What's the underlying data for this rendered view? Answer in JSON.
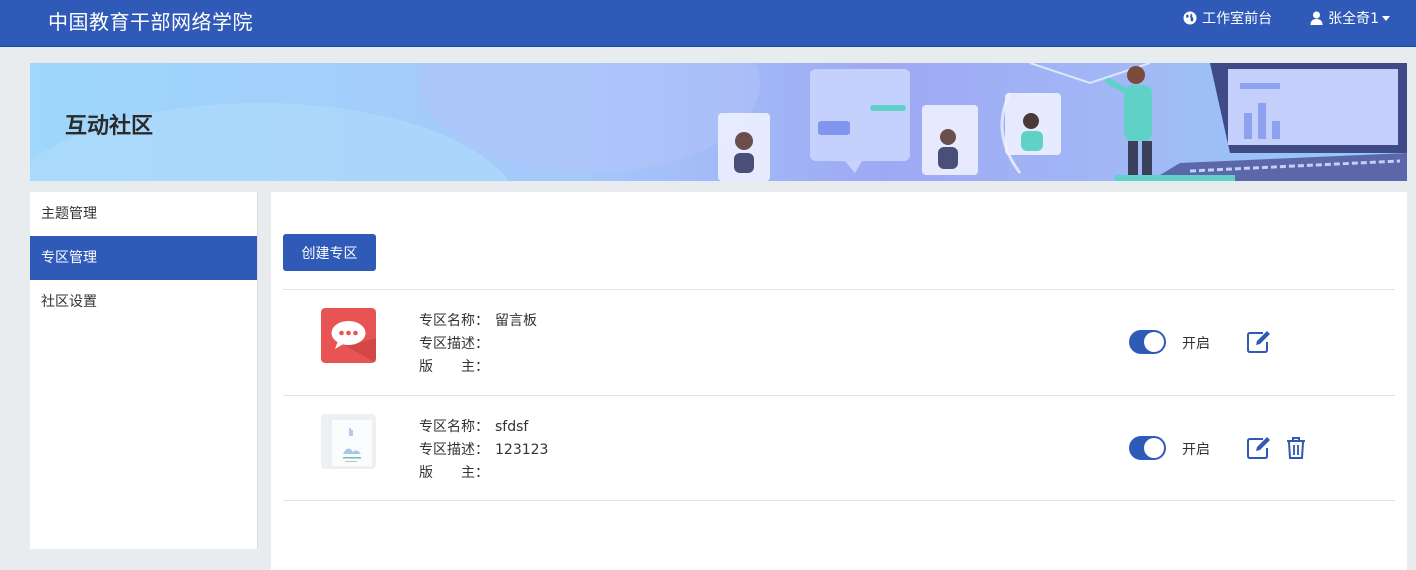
{
  "header": {
    "title": "中国教育干部网络学院",
    "studio_link": "工作室前台",
    "user_name": "张全奇1",
    "icons": {
      "studio": "globe-icon",
      "user": "user-icon"
    }
  },
  "banner": {
    "title": "互动社区"
  },
  "sidebar": {
    "items": [
      {
        "label": "主题管理",
        "active": false
      },
      {
        "label": "专区管理",
        "active": true
      },
      {
        "label": "社区设置",
        "active": false
      }
    ]
  },
  "main": {
    "create_button": "创建专区",
    "field_labels": {
      "name": "专区名称：",
      "desc": "专区描述：",
      "moderator": "版　　主："
    },
    "zones": [
      {
        "name": "留言板",
        "desc": "",
        "moderator": "",
        "enabled": true,
        "status_text": "开启",
        "icon": "chat-bubble-icon",
        "deletable": false
      },
      {
        "name": "sfdsf",
        "desc": "123123",
        "moderator": "",
        "enabled": true,
        "status_text": "开启",
        "icon": "image-thumbnail-icon",
        "deletable": true
      }
    ]
  },
  "colors": {
    "primary": "#2f5ab7",
    "chat_icon_bg": "#e85454"
  }
}
